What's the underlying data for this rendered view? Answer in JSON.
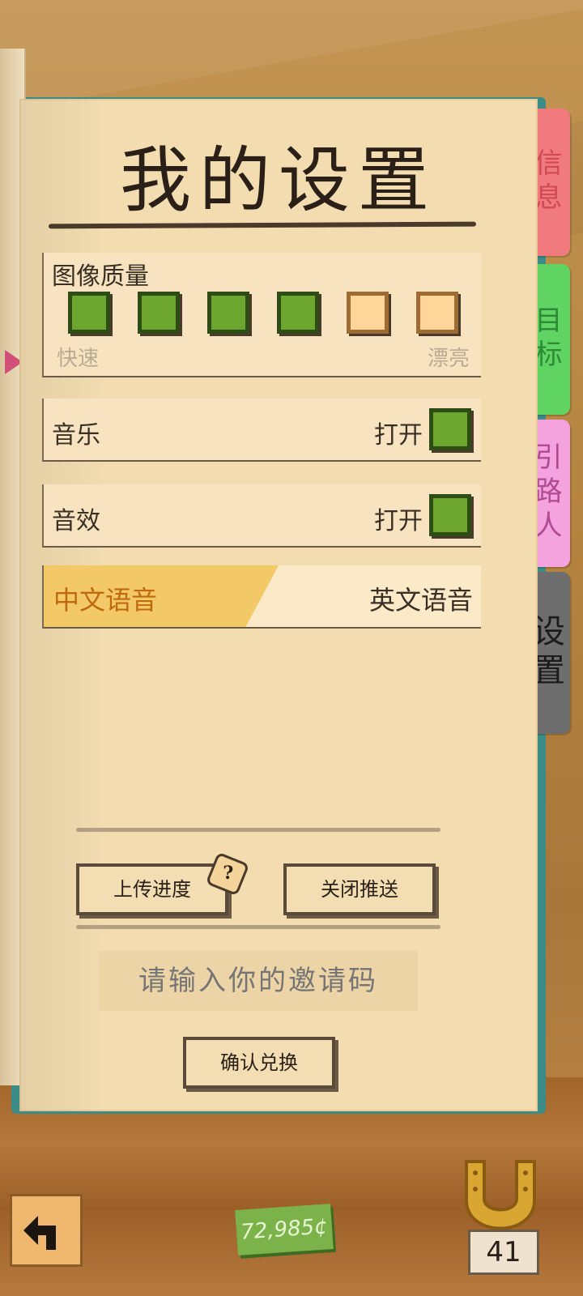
{
  "page": {
    "title": "我的设置",
    "tabs": [
      {
        "id": "info",
        "label": "信息"
      },
      {
        "id": "goal",
        "label": "目标"
      },
      {
        "id": "guide",
        "label": "引路人"
      },
      {
        "id": "settings",
        "label": "设置"
      }
    ]
  },
  "quality": {
    "label": "图像质量",
    "left_label": "快速",
    "right_label": "漂亮",
    "level": 4,
    "max_level": 6
  },
  "music": {
    "label": "音乐",
    "state": "打开"
  },
  "sfx": {
    "label": "音效",
    "state": "打开"
  },
  "language": {
    "chinese": "中文语音",
    "english": "英文语音",
    "selected": "chinese"
  },
  "buttons": {
    "upload": "上传进度",
    "help": "?",
    "push": "关闭推送",
    "confirm": "确认兑换"
  },
  "invite": {
    "placeholder": "请输入你的邀请码"
  },
  "hud": {
    "money": "72,985¢",
    "horseshoes": "41"
  },
  "colors": {
    "tab_info": "#f07a7e",
    "tab_goal": "#5fd463",
    "tab_guide": "#f4a3de",
    "tab_settings": "#6e6e6e",
    "selected_language": "#f3c867"
  }
}
